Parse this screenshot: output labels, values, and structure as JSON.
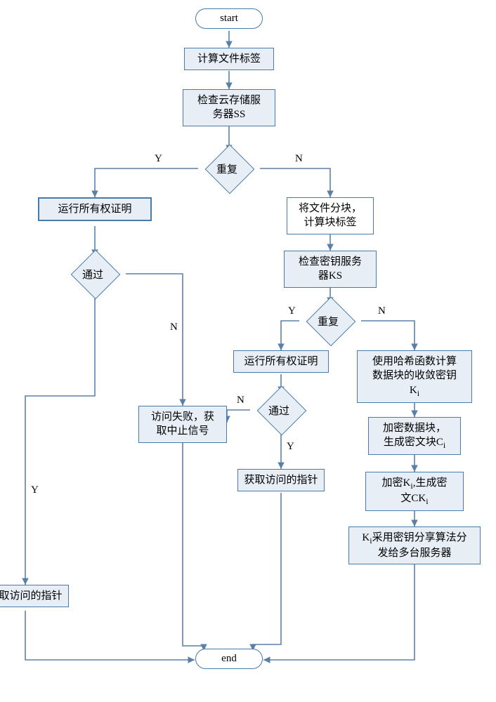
{
  "nodes": {
    "start": "start",
    "end": "end",
    "calc_file_tag": "计算文件标签",
    "check_ss": "检查云存储服\n务器SS",
    "dup1": "重复",
    "run_pow_left": "运行所有权证明",
    "pass_left": "通过",
    "get_ptr_left": "获取访问的指针",
    "access_fail": "访问失败，获\n取中止信号",
    "split_blocks": "将文件分块，\n计算块标签",
    "check_ks": "检查密钥服务\n器KS",
    "dup2": "重复",
    "run_pow_mid": "运行所有权证明",
    "pass_mid": "通过",
    "get_ptr_mid": "获取访问的指针",
    "hash_key": "使用哈希函数计算\n数据块的收敛密钥\nK",
    "hash_key_sub": "i",
    "encrypt_block": "加密数据块，\n生成密文块C",
    "encrypt_block_sub": "i",
    "encrypt_k": "加密K",
    "encrypt_k_sub1": "i",
    "encrypt_k2": ",生成密\n文CK",
    "encrypt_k_sub2": "i",
    "keyshare": "K",
    "keyshare_sub": "i",
    "keyshare2": "采用密钥分享算法分\n发给多台服务器"
  },
  "labels": {
    "Y": "Y",
    "N": "N"
  },
  "chart_data": {
    "type": "flowchart",
    "direction": "top-down",
    "title": "",
    "nodes": [
      {
        "id": "start",
        "kind": "terminator",
        "text": "start"
      },
      {
        "id": "calc_file_tag",
        "kind": "process",
        "text": "计算文件标签"
      },
      {
        "id": "check_ss",
        "kind": "process",
        "text": "检查云存储服务器SS"
      },
      {
        "id": "dup1",
        "kind": "decision",
        "text": "重复"
      },
      {
        "id": "run_pow_left",
        "kind": "process",
        "text": "运行所有权证明"
      },
      {
        "id": "pass_left",
        "kind": "decision",
        "text": "通过"
      },
      {
        "id": "get_ptr_left",
        "kind": "process",
        "text": "获取访问的指针"
      },
      {
        "id": "access_fail",
        "kind": "process",
        "text": "访问失败，获取中止信号"
      },
      {
        "id": "split_blocks",
        "kind": "process",
        "text": "将文件分块，计算块标签"
      },
      {
        "id": "check_ks",
        "kind": "process",
        "text": "检查密钥服务器KS"
      },
      {
        "id": "dup2",
        "kind": "decision",
        "text": "重复"
      },
      {
        "id": "run_pow_mid",
        "kind": "process",
        "text": "运行所有权证明"
      },
      {
        "id": "pass_mid",
        "kind": "decision",
        "text": "通过"
      },
      {
        "id": "get_ptr_mid",
        "kind": "process",
        "text": "获取访问的指针"
      },
      {
        "id": "hash_key",
        "kind": "process",
        "text": "使用哈希函数计算数据块的收敛密钥Ki"
      },
      {
        "id": "encrypt_block",
        "kind": "process",
        "text": "加密数据块，生成密文块Ci"
      },
      {
        "id": "encrypt_k",
        "kind": "process",
        "text": "加密Ki,生成密文CKi"
      },
      {
        "id": "keyshare",
        "kind": "process",
        "text": "Ki采用密钥分享算法分发给多台服务器"
      },
      {
        "id": "end",
        "kind": "terminator",
        "text": "end"
      }
    ],
    "edges": [
      {
        "from": "start",
        "to": "calc_file_tag"
      },
      {
        "from": "calc_file_tag",
        "to": "check_ss"
      },
      {
        "from": "check_ss",
        "to": "dup1"
      },
      {
        "from": "dup1",
        "to": "run_pow_left",
        "label": "Y"
      },
      {
        "from": "dup1",
        "to": "split_blocks",
        "label": "N"
      },
      {
        "from": "run_pow_left",
        "to": "pass_left"
      },
      {
        "from": "pass_left",
        "to": "get_ptr_left",
        "label": "Y"
      },
      {
        "from": "pass_left",
        "to": "access_fail",
        "label": "N"
      },
      {
        "from": "get_ptr_left",
        "to": "end"
      },
      {
        "from": "access_fail",
        "to": "end"
      },
      {
        "from": "split_blocks",
        "to": "check_ks"
      },
      {
        "from": "check_ks",
        "to": "dup2"
      },
      {
        "from": "dup2",
        "to": "run_pow_mid",
        "label": "Y"
      },
      {
        "from": "dup2",
        "to": "hash_key",
        "label": "N"
      },
      {
        "from": "run_pow_mid",
        "to": "pass_mid"
      },
      {
        "from": "pass_mid",
        "to": "get_ptr_mid",
        "label": "Y"
      },
      {
        "from": "pass_mid",
        "to": "access_fail",
        "label": "N"
      },
      {
        "from": "get_ptr_mid",
        "to": "end"
      },
      {
        "from": "hash_key",
        "to": "encrypt_block"
      },
      {
        "from": "encrypt_block",
        "to": "encrypt_k"
      },
      {
        "from": "encrypt_k",
        "to": "keyshare"
      },
      {
        "from": "keyshare",
        "to": "end"
      }
    ]
  }
}
